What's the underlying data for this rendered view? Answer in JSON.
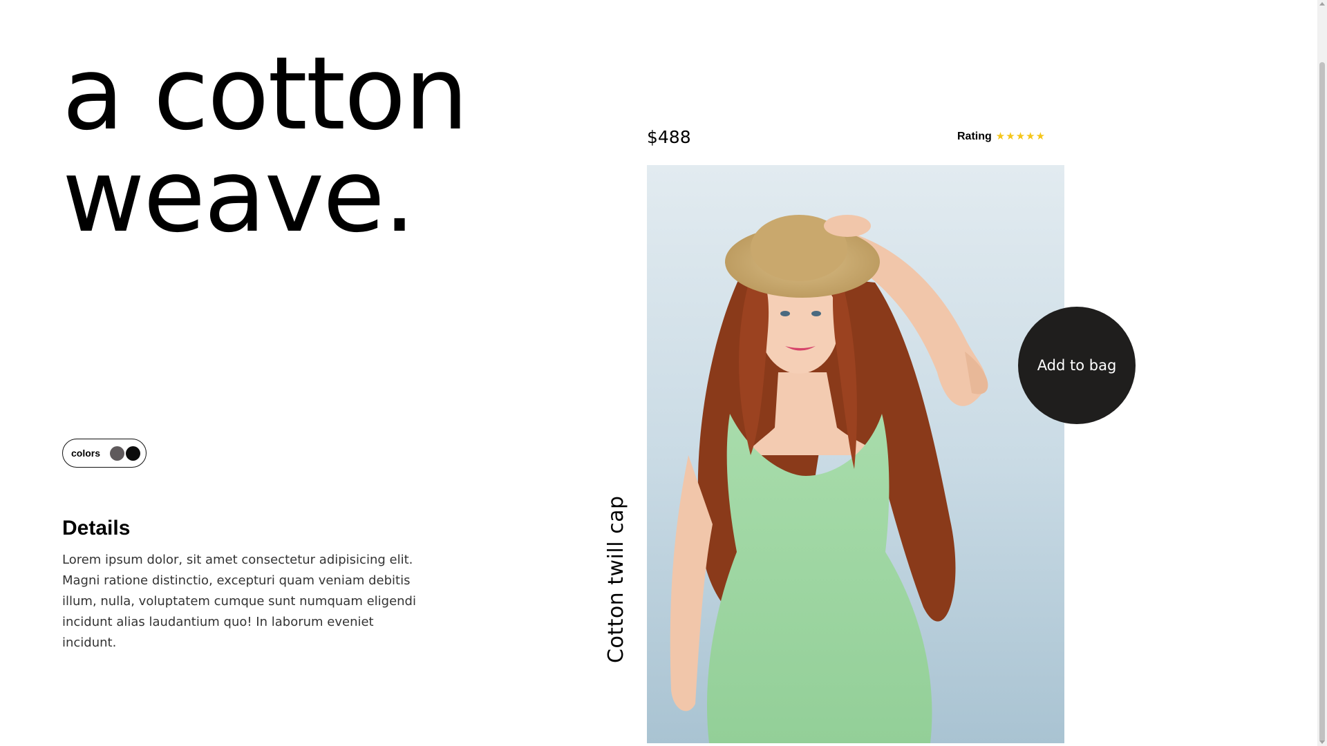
{
  "hero": {
    "line1": "a cotton",
    "line2": "weave."
  },
  "colors": {
    "label": "colors",
    "swatches": [
      "#5f5a5c",
      "#0c0c0c"
    ]
  },
  "details": {
    "title": "Details",
    "text": "Lorem ipsum dolor, sit amet consectetur adipisicing elit. Magni ratione distinctio, excepturi quam veniam debitis illum, nulla, voluptatem cumque sunt numquam eligendi incidunt alias laudantium quo! In laborum eveniet incidunt."
  },
  "product": {
    "name": "Cotton twill cap",
    "price": "$488",
    "rating_label": "Rating",
    "rating_value": 5,
    "rating_max": 5,
    "star_color": "#f5c518",
    "add_to_bag": "Add to bag",
    "button_color": "#1f1e1d"
  }
}
